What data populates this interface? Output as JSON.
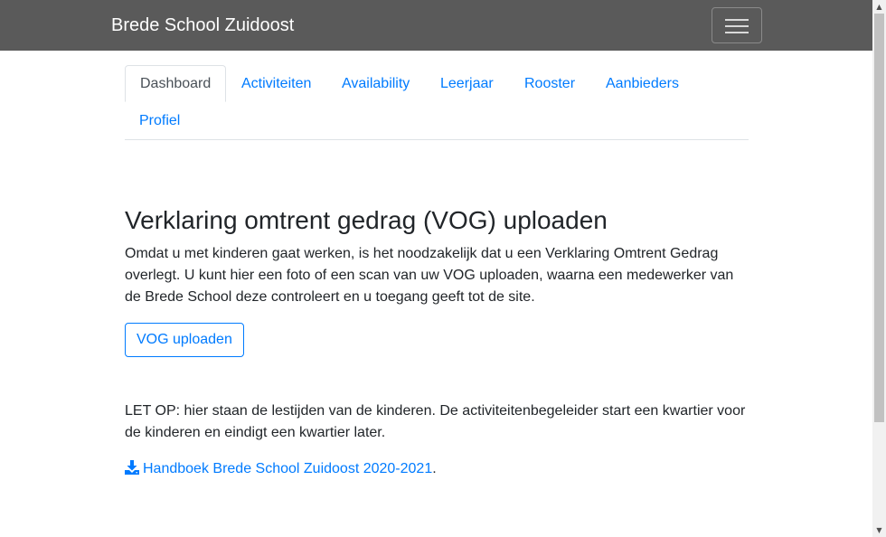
{
  "navbar": {
    "brand": "Brede School Zuidoost",
    "toggler_icon": "menu-icon"
  },
  "tabs": [
    {
      "label": "Dashboard",
      "active": true
    },
    {
      "label": "Activiteiten",
      "active": false
    },
    {
      "label": "Availability",
      "active": false
    },
    {
      "label": "Leerjaar",
      "active": false
    },
    {
      "label": "Rooster",
      "active": false
    },
    {
      "label": "Aanbieders",
      "active": false
    },
    {
      "label": "Profiel",
      "active": false
    }
  ],
  "vog": {
    "heading": "Verklaring omtrent gedrag (VOG) uploaden",
    "text": "Omdat u met kinderen gaat werken, is het noodzakelijk dat u een Verklaring Omtrent Gedrag overlegt. U kunt hier een foto of een scan van uw VOG uploaden, waarna een medewerker van de Brede School deze controleert en u toegang geeft tot de site.",
    "button": "VOG uploaden"
  },
  "note": "LET OP: hier staan de lestijden van de kinderen. De activiteitenbegeleider start een kwartier voor de kinderen en eindigt een kwartier later.",
  "download": {
    "icon": "download-icon",
    "label": "Handboek Brede School Zuidoost 2020-2021",
    "suffix": "."
  },
  "colors": {
    "navbar": "#5a5a5a",
    "link": "#007bff",
    "text": "#212529",
    "border": "#dee2e6"
  }
}
